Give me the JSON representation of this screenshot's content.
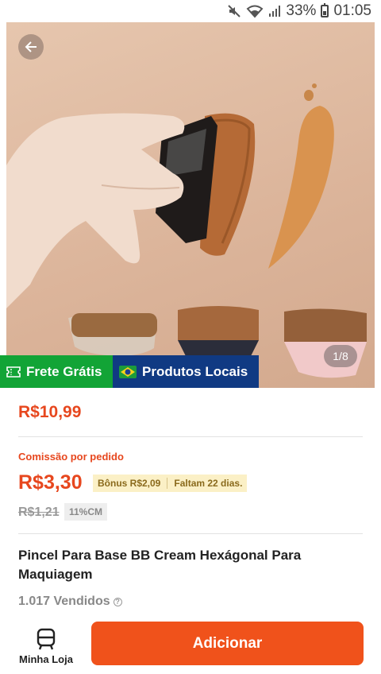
{
  "status_bar": {
    "battery": "33%",
    "time": "01:05",
    "icons": [
      "mute-icon",
      "wifi-icon",
      "signal-icon",
      "battery-icon"
    ]
  },
  "product_image": {
    "counter": "1/8"
  },
  "badges": {
    "shipping": "Frete Grátis",
    "local": "Produtos Locais"
  },
  "price": "R$10,99",
  "commission": {
    "label": "Comissão por pedido",
    "value": "R$3,30",
    "bonus": "Bônus R$2,09",
    "remaining": "Faltam 22 dias."
  },
  "old_price": "R$1,21",
  "commission_rate": "11%CM",
  "product_title": "Pincel Para Base BB Cream Hexágonal Para Maquiagem",
  "sold": "1.017 Vendidos",
  "bottom_bar": {
    "store_label": "Minha Loja",
    "add_label": "Adicionar"
  },
  "colors": {
    "accent": "#f0521b",
    "price": "#e7471e",
    "shipping_badge": "#12a436",
    "local_badge": "#103a83"
  }
}
